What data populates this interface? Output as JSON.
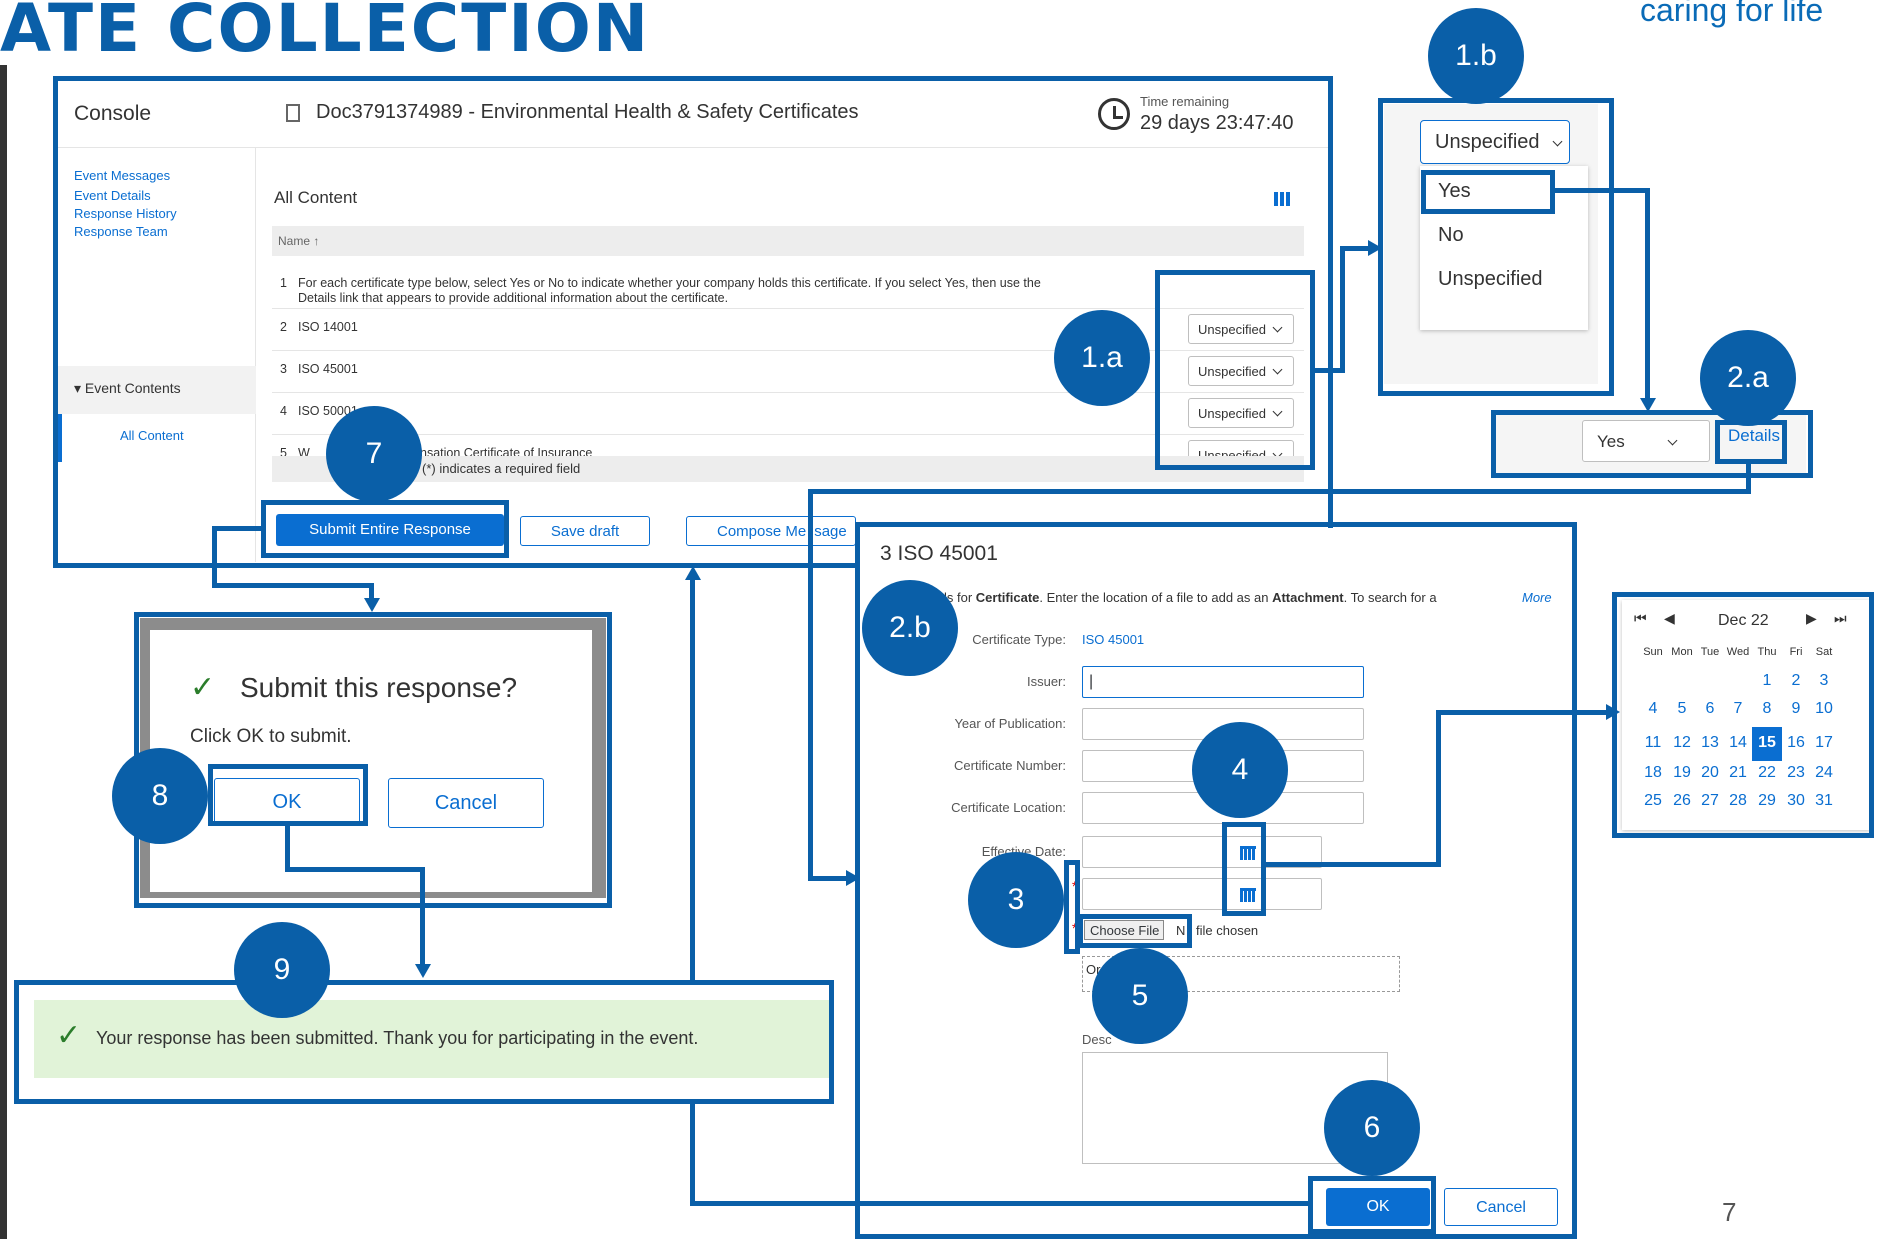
{
  "slide": {
    "title": "ATE COLLECTION",
    "tagline": "caring for life",
    "page_number": "7"
  },
  "console": {
    "label": "Console",
    "doc_title": "Doc3791374989 - Environmental Health & Safety Certificates",
    "time_remaining_label": "Time remaining",
    "time_remaining_value": "29 days 23:47:40",
    "sidebar": {
      "links": [
        "Event Messages",
        "Event Details",
        "Response History",
        "Response Team"
      ],
      "section": "▾  Event Contents",
      "active_item": "All Content"
    },
    "content_title": "All Content",
    "name_header": "Name ↑",
    "rows": [
      {
        "num": "1",
        "text": "For each certificate type below, select Yes or No to indicate whether your company holds this certificate. If you select Yes, then use the",
        "text2": "Details link that appears to provide additional information about the certificate."
      },
      {
        "num": "2",
        "text": "ISO 14001",
        "value": "Unspecified"
      },
      {
        "num": "3",
        "text": "ISO 45001",
        "value": "Unspecified"
      },
      {
        "num": "4",
        "text": "ISO 50001",
        "value": "Unspecified"
      },
      {
        "num": "5",
        "text": "W",
        "text_tail": "nsation Certificate of Insurance",
        "value": "Unspecified"
      }
    ],
    "required_note": "(*) indicates a required field",
    "buttons": {
      "submit": "Submit Entire Response",
      "save_draft": "Save draft",
      "compose": "Compose Me",
      "compose_tail": "sage"
    }
  },
  "dropdown_popup": {
    "selected": "Unspecified",
    "options": [
      "Yes",
      "No",
      "Unspecified"
    ]
  },
  "details_row": {
    "value": "Yes",
    "link": "Details"
  },
  "dialog": {
    "title": "3 ISO 45001",
    "intro_prefix": "ls for ",
    "intro_bold1": "Certificate",
    "intro_mid": ". Enter the location of a file to add as an ",
    "intro_bold2": "Attachment",
    "intro_suffix": ". To search for a",
    "more": "More",
    "cert_type_label": "Certificate Type:",
    "cert_type_value": "ISO 45001",
    "fields": [
      {
        "label": "Issuer:",
        "value": "|"
      },
      {
        "label": "Year of Publication:",
        "value": ""
      },
      {
        "label": "Certificate Number:",
        "value": ""
      },
      {
        "label": "Certificate Location:",
        "value": ""
      },
      {
        "label": "Effective Date:",
        "value": ""
      }
    ],
    "required_star": "*",
    "choose_file": "Choose File",
    "no_file": "file chosen",
    "no_file_prefix": "N",
    "or_label": "Or",
    "desc_label": "Desc",
    "ok": "OK",
    "cancel": "Cancel"
  },
  "calendar": {
    "month": "Dec 22",
    "first": "⏮",
    "prev": "◀",
    "next": "▶",
    "last": "⏭",
    "days_of_week": [
      "Sun",
      "Mon",
      "Tue",
      "Wed",
      "Thu",
      "Fri",
      "Sat"
    ],
    "weeks": [
      [
        "",
        "",
        "",
        "",
        "1",
        "2",
        "3"
      ],
      [
        "4",
        "5",
        "6",
        "7",
        "8",
        "9",
        "10"
      ],
      [
        "11",
        "12",
        "13",
        "14",
        "15",
        "16",
        "17"
      ],
      [
        "18",
        "19",
        "20",
        "21",
        "22",
        "23",
        "24"
      ],
      [
        "25",
        "26",
        "27",
        "28",
        "29",
        "30",
        "31"
      ]
    ],
    "selected_day": "15"
  },
  "confirm": {
    "title": "Submit this response?",
    "message": "Click OK to submit.",
    "ok": "OK",
    "cancel": "Cancel"
  },
  "success": {
    "message": "Your response has been submitted.  Thank you for participating in the event."
  },
  "callouts": [
    "1.a",
    "1.b",
    "2.a",
    "2.b",
    "3",
    "4",
    "5",
    "6",
    "7",
    "8",
    "9"
  ],
  "colors": {
    "annotation_blue": "#0a5fa8",
    "sap_blue": "#0a6ed1",
    "success_bg": "#e1f3d8",
    "check_green": "#2b7d2b"
  }
}
